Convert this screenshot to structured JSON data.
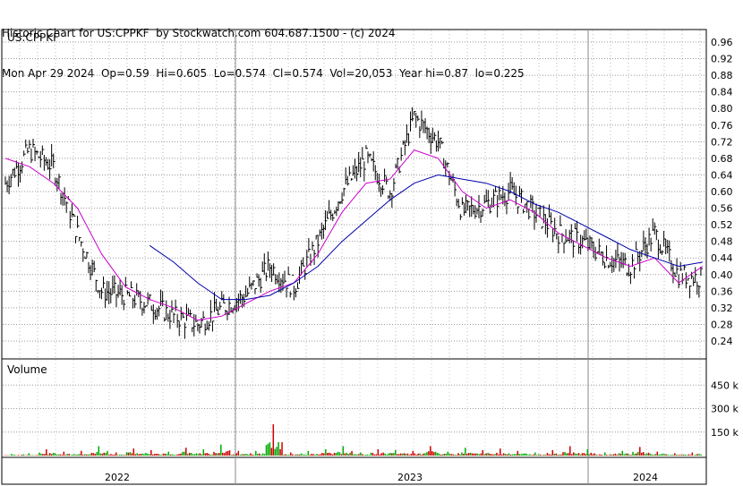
{
  "header": {
    "line1": "Historic Chart for US:CPPKF  by Stockwatch.com 604.687.1500 - (c) 2024",
    "line2": "Mon Apr 29 2024  Op=0.59  Hi=0.605  Lo=0.574  Cl=0.574  Vol=20,053  Year hi=0.87  lo=0.225"
  },
  "chart_data": [
    {
      "type": "line",
      "title": "US:CPPKF",
      "y_tick_labels": [
        "0.96",
        "0.92",
        "0.88",
        "0.84",
        "0.80",
        "0.76",
        "0.72",
        "0.68",
        "0.64",
        "0.60",
        "0.56",
        "0.52",
        "0.48",
        "0.44",
        "0.40",
        "0.36",
        "0.32",
        "0.28",
        "0.24"
      ],
      "ylim": [
        0.2,
        0.98
      ],
      "x_tick_labels": [
        "2022",
        "2023",
        "2024"
      ],
      "x": [
        "2021-11",
        "2021-12",
        "2022-01",
        "2022-02",
        "2022-03",
        "2022-04",
        "2022-05",
        "2022-06",
        "2022-07",
        "2022-08",
        "2022-09",
        "2022-10",
        "2022-11",
        "2022-12",
        "2023-01",
        "2023-02",
        "2023-03",
        "2023-04",
        "2023-05",
        "2023-06",
        "2023-07",
        "2023-08",
        "2023-09",
        "2023-10",
        "2023-11",
        "2023-12",
        "2024-01",
        "2024-02",
        "2024-03",
        "2024-04"
      ],
      "series": [
        {
          "values": [
            0.62,
            0.7,
            0.66,
            0.5,
            0.36,
            0.35,
            0.33,
            0.3,
            0.28,
            0.32,
            0.35,
            0.42,
            0.37,
            0.48,
            0.6,
            0.68,
            0.6,
            0.78,
            0.72,
            0.55,
            0.57,
            0.6,
            0.55,
            0.5,
            0.48,
            0.44,
            0.42,
            0.5,
            0.4,
            0.39
          ]
        },
        {
          "values": [
            null,
            null,
            null,
            null,
            null,
            null,
            0.47,
            0.43,
            0.38,
            0.34,
            0.34,
            0.35,
            0.38,
            0.42,
            0.48,
            0.53,
            0.58,
            0.62,
            0.64,
            0.63,
            0.62,
            0.6,
            0.57,
            0.55,
            0.52,
            0.49,
            0.46,
            0.44,
            0.42,
            0.43
          ]
        },
        {
          "values": [
            0.68,
            0.66,
            0.62,
            0.56,
            0.45,
            0.37,
            0.34,
            0.32,
            0.29,
            0.3,
            0.33,
            0.36,
            0.38,
            0.45,
            0.55,
            0.62,
            0.63,
            0.7,
            0.68,
            0.6,
            0.56,
            0.58,
            0.55,
            0.5,
            0.47,
            0.44,
            0.42,
            0.44,
            0.38,
            0.42
          ]
        }
      ],
      "colors": {
        "price": "#000000",
        "ma_short": "#cc00cc",
        "ma_long": "#0000aa"
      }
    },
    {
      "type": "bar",
      "title": "Volume",
      "y_tick_labels": [
        "450 k",
        "300 k",
        "150 k"
      ],
      "ylim": [
        0,
        600
      ],
      "values_k": [
        10,
        15,
        40,
        25,
        30,
        60,
        20,
        45,
        35,
        25,
        50,
        40,
        70,
        30,
        30,
        200,
        20,
        30,
        40,
        60,
        20,
        40,
        35,
        30,
        60,
        25,
        50,
        35,
        45,
        30,
        20,
        35,
        60,
        40,
        20,
        30,
        55,
        25,
        15,
        20
      ],
      "colors": {
        "up": "#00aa00",
        "down": "#cc0000"
      }
    }
  ]
}
